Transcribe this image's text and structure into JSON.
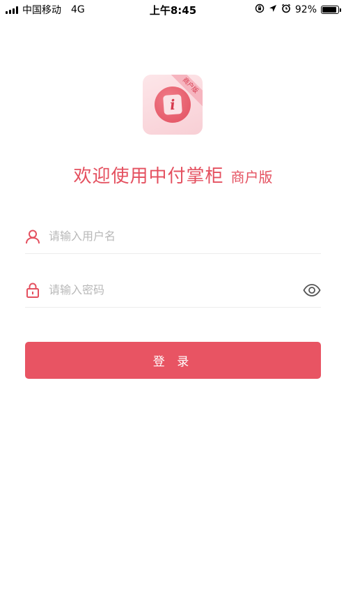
{
  "status_bar": {
    "carrier": "中国移动",
    "network": "4G",
    "time": "上午8:45",
    "battery": "92%",
    "battery_level": 0.92
  },
  "logo": {
    "badge": "商户版",
    "glyph": "i"
  },
  "welcome": {
    "title": "欢迎使用中付掌柜",
    "subtitle": "商户版"
  },
  "form": {
    "username_placeholder": "请输入用户名",
    "password_placeholder": "请输入密码",
    "login_label": "登 录"
  },
  "colors": {
    "accent": "#e85463",
    "icon": "#e4505f"
  },
  "icons": [
    "user-icon",
    "lock-icon",
    "eye-icon"
  ]
}
